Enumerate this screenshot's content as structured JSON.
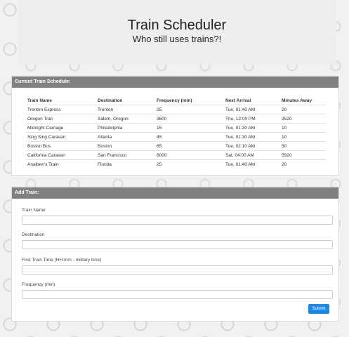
{
  "header": {
    "title": "Train Scheduler",
    "subtitle": "Who still uses trains?!"
  },
  "schedule": {
    "heading": "Current Train Schedule:",
    "columns": [
      "Train Name",
      "Destination",
      "Frequency (min)",
      "Next Arrival",
      "Minutes Away"
    ],
    "rows": [
      [
        "Trenton Express",
        "Trenton",
        "25",
        "Tue, 01:40 AM",
        "20"
      ],
      [
        "Oregon Trail",
        "Salem, Oregon",
        "3600",
        "Thu, 12:00 PM",
        "3520"
      ],
      [
        "Midnight Carriage",
        "Philadelphia",
        "15",
        "Tue, 01:30 AM",
        "10"
      ],
      [
        "Sing Sing Caravan",
        "Atlanta",
        "45",
        "Tue, 01:30 AM",
        "10"
      ],
      [
        "Boston Bus",
        "Boston",
        "65",
        "Tue, 02:10 AM",
        "50"
      ],
      [
        "California Caravan",
        "San Francisco",
        "6000",
        "Sat, 04:00 AM",
        "5920"
      ],
      [
        "Analben's Train",
        "Florida",
        "25",
        "Tue, 01:40 AM",
        "20"
      ]
    ]
  },
  "form": {
    "heading": "Add Train:",
    "train_name_label": "Train Name",
    "train_name_value": "",
    "destination_label": "Destination",
    "destination_value": "",
    "first_time_label": "First Train Time (HH:mm - military time)",
    "first_time_value": "",
    "frequency_label": "Frequency (min)",
    "frequency_value": "",
    "submit_label": "Submit"
  },
  "colors": {
    "panel_heading": "#808080",
    "submit_button": "#1e88e5",
    "page_background": "#f1f1f1",
    "jumbotron": "#eeeeee"
  }
}
